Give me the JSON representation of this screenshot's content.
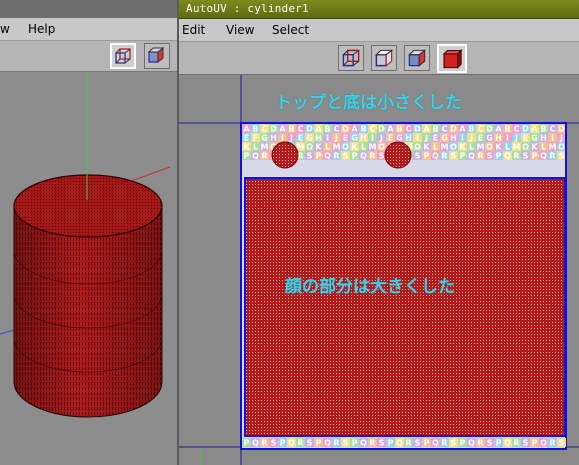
{
  "left_window": {
    "menu": [
      {
        "label": "w"
      },
      {
        "label": "Help"
      }
    ],
    "view_buttons": [
      {
        "name": "wireframe-cube-icon",
        "selected": true
      },
      {
        "name": "shaded-cube-icon",
        "selected": false
      }
    ]
  },
  "autouv_window": {
    "title": "AutoUV : cylinder1",
    "menu": [
      {
        "label": "Edit"
      },
      {
        "label": "View"
      },
      {
        "label": "Select"
      }
    ],
    "view_buttons": [
      {
        "name": "wireframe-cube-icon",
        "selected": false
      },
      {
        "name": "wireframe-cube-icon",
        "selected": false
      },
      {
        "name": "half-shaded-cube-icon",
        "selected": false
      },
      {
        "name": "solid-red-cube-icon",
        "selected": true
      }
    ],
    "annotations": {
      "top_bottom": "トップと底は小さくした",
      "face": "顔の部分は大きくした"
    },
    "texture_rows": [
      "ABCDABCDABCDABCDABCDABCDABCDABCDABCD",
      "EFGHIJEGHIJEGHIJEGHIJEGHIJEGHIJEGHIJ",
      "KLMOKLMOKLMOKLMOKLMOKLMOKLMOKLMOKLMO",
      "PQRSPQRSPQRSPQRSPQRSPQRSPQRSPQRSPQRS"
    ],
    "texture_bottom_row": "PQRSPQRSPQRSPQRSPQRSPQRSPQRSPQRSPQRS"
  },
  "colors": {
    "mesh_red": "#b31c1c",
    "wire_dark": "#3a0000",
    "uv_border": "#1010e0",
    "annotation_cyan": "#3fd0e6",
    "title_bar_green": "#6f7a18"
  }
}
